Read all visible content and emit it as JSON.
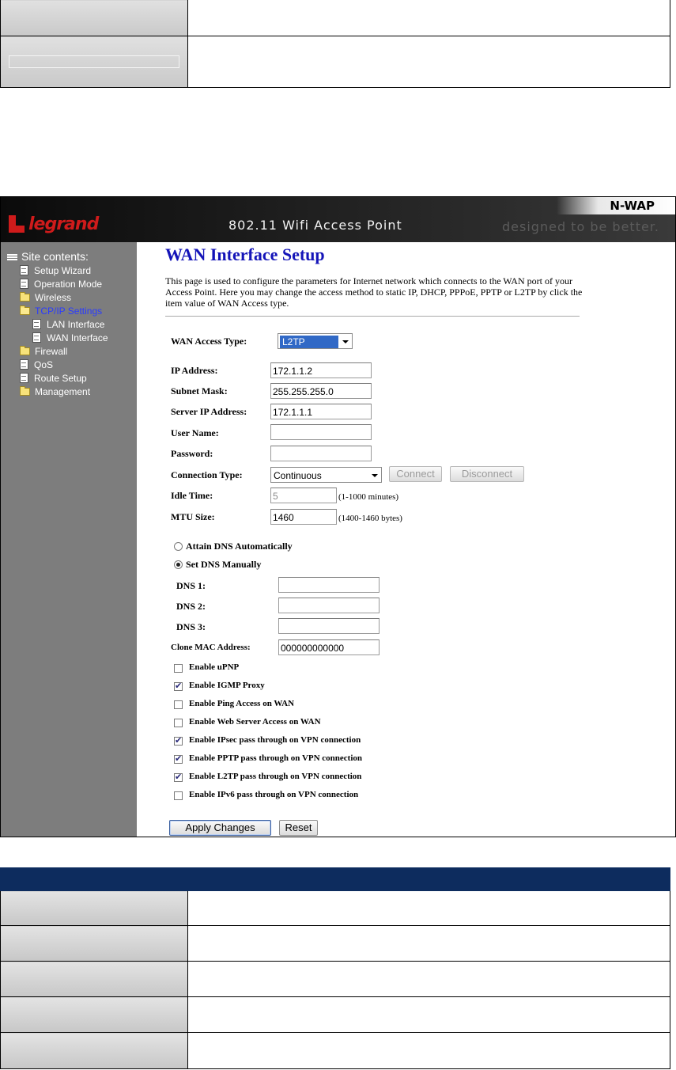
{
  "banner": {
    "logo": "legrand",
    "title": "802.11 Wifi Access Point",
    "model": "N-WAP",
    "tagline": "designed to be better."
  },
  "sidebar": {
    "root": "Site contents:",
    "items": [
      {
        "label": "Setup Wizard",
        "icon": "document-icon"
      },
      {
        "label": "Operation Mode",
        "icon": "document-icon"
      },
      {
        "label": "Wireless",
        "icon": "folder-icon"
      },
      {
        "label": "TCP/IP Settings",
        "icon": "open-folder-icon",
        "active": true
      },
      {
        "label": "LAN Interface",
        "icon": "document-icon"
      },
      {
        "label": "WAN Interface",
        "icon": "document-icon"
      },
      {
        "label": "Firewall",
        "icon": "folder-icon"
      },
      {
        "label": "QoS",
        "icon": "document-icon"
      },
      {
        "label": "Route Setup",
        "icon": "document-icon"
      },
      {
        "label": "Management",
        "icon": "folder-icon"
      }
    ]
  },
  "main": {
    "title": "WAN Interface Setup",
    "description": "This page is used to configure the parameters for Internet network which connects to the WAN port of your Access Point. Here you may change the access method to static IP, DHCP, PPPoE, PPTP or L2TP by click the item value of WAN Access type.",
    "wan_access_type": {
      "label": "WAN Access Type:",
      "value": "L2TP"
    },
    "ip_address": {
      "label": "IP Address:",
      "value": "172.1.1.2"
    },
    "subnet_mask": {
      "label": "Subnet Mask:",
      "value": "255.255.255.0"
    },
    "server_ip": {
      "label": "Server IP Address:",
      "value": "172.1.1.1"
    },
    "user_name": {
      "label": "User Name:",
      "value": ""
    },
    "password": {
      "label": "Password:",
      "value": ""
    },
    "connection_type": {
      "label": "Connection Type:",
      "value": "Continuous",
      "connect": "Connect",
      "disconnect": "Disconnect"
    },
    "idle_time": {
      "label": "Idle Time:",
      "value": "5",
      "hint": "(1-1000 minutes)"
    },
    "mtu_size": {
      "label": "MTU Size:",
      "value": "1460",
      "hint": "(1400-1460 bytes)"
    },
    "dns_auto": {
      "label": "Attain DNS Automatically",
      "selected": false
    },
    "dns_manual": {
      "label": "Set DNS Manually",
      "selected": true
    },
    "dns1": {
      "label": "DNS 1:",
      "value": ""
    },
    "dns2": {
      "label": "DNS 2:",
      "value": ""
    },
    "dns3": {
      "label": "DNS 3:",
      "value": ""
    },
    "clone_mac": {
      "label": "Clone MAC Address:",
      "value": "000000000000"
    },
    "checkboxes": [
      {
        "label": "Enable uPNP",
        "checked": false
      },
      {
        "label": "Enable IGMP Proxy",
        "checked": true
      },
      {
        "label": "Enable Ping Access on WAN",
        "checked": false
      },
      {
        "label": "Enable Web Server Access on WAN",
        "checked": false
      },
      {
        "label": "Enable IPsec pass through on VPN connection",
        "checked": true
      },
      {
        "label": "Enable PPTP pass through on VPN connection",
        "checked": true
      },
      {
        "label": "Enable L2TP pass through on VPN connection",
        "checked": true
      },
      {
        "label": "Enable IPv6 pass through on VPN connection",
        "checked": false
      }
    ],
    "apply_button": "Apply Changes",
    "reset_button": "Reset"
  },
  "colors": {
    "sidebar_bg": "#7d7d7d",
    "title_blue": "#1414b8",
    "table_header": "#0d2c5e",
    "logo_red": "#cf1b1b"
  }
}
